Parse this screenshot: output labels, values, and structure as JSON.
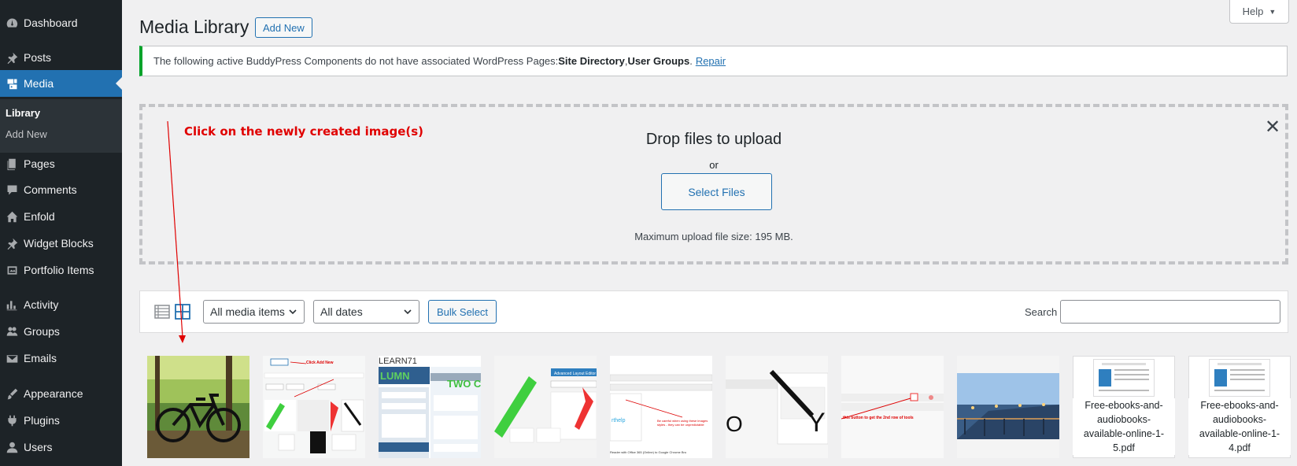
{
  "sidebar": {
    "items": [
      {
        "label": "Dashboard",
        "icon": "dashboard-icon"
      },
      {
        "label": "Posts",
        "icon": "pin-icon"
      },
      {
        "label": "Media",
        "icon": "media-icon"
      },
      {
        "label": "Pages",
        "icon": "pages-icon"
      },
      {
        "label": "Comments",
        "icon": "comment-icon"
      },
      {
        "label": "Enfold",
        "icon": "home-icon"
      },
      {
        "label": "Widget Blocks",
        "icon": "pin-icon"
      },
      {
        "label": "Portfolio Items",
        "icon": "portfolio-icon"
      },
      {
        "label": "Activity",
        "icon": "activity-icon"
      },
      {
        "label": "Groups",
        "icon": "groups-icon"
      },
      {
        "label": "Emails",
        "icon": "mail-icon"
      },
      {
        "label": "Appearance",
        "icon": "brush-icon"
      },
      {
        "label": "Plugins",
        "icon": "plugin-icon"
      },
      {
        "label": "Users",
        "icon": "user-icon"
      }
    ],
    "submenu": {
      "library": "Library",
      "add_new": "Add New"
    }
  },
  "header": {
    "help": "Help",
    "title": "Media Library",
    "add_new": "Add New"
  },
  "notice": {
    "text_before": "The following active BuddyPress Components do not have associated WordPress Pages: ",
    "component_1": "Site Directory",
    "separator": ", ",
    "component_2": "User Groups",
    "period": ".",
    "link": "Repair"
  },
  "uploader": {
    "title": "Drop files to upload",
    "or": "or",
    "button": "Select Files",
    "max_size": "Maximum upload file size: 195 MB.",
    "close": "✕"
  },
  "annotation": "Click on the newly created image(s)",
  "toolbar": {
    "filter_type": "All media items",
    "filter_date": "All dates",
    "bulk_select": "Bulk Select",
    "search_label": "Search",
    "search_value": ""
  },
  "grid": {
    "pdf_1": "Free-ebooks-and-audiobooks-available-online-1-5.pdf",
    "pdf_2": "Free-ebooks-and-audiobooks-available-online-1-4.pdf"
  },
  "colors": {
    "sidebar_bg": "#1d2327",
    "accent": "#2271b1",
    "notice_border": "#00a32a",
    "annotation": "#e00000"
  }
}
